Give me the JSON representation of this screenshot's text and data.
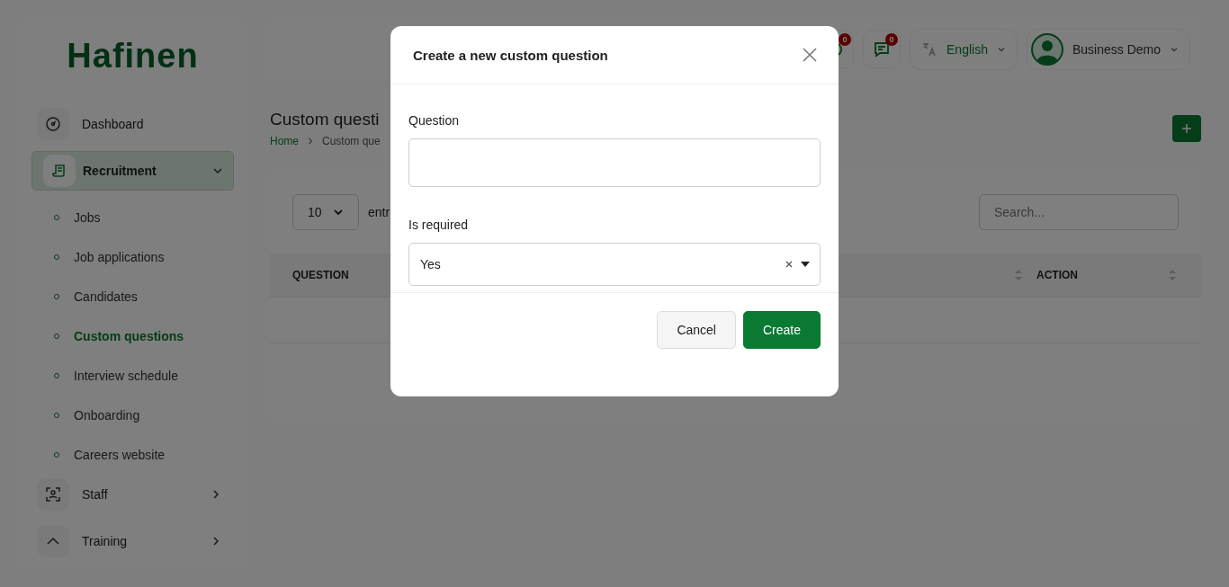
{
  "logo": "Hafinen",
  "sidebar": {
    "items": [
      {
        "label": "Dashboard",
        "kind": "link",
        "selected": false
      },
      {
        "label": "Recruitment",
        "kind": "group",
        "expanded": true,
        "selected": true,
        "children": [
          {
            "label": "Jobs",
            "selected": false
          },
          {
            "label": "Job applications",
            "selected": false
          },
          {
            "label": "Candidates",
            "selected": false
          },
          {
            "label": "Custom questions",
            "selected": true
          },
          {
            "label": "Interview schedule",
            "selected": false
          },
          {
            "label": "Onboarding",
            "selected": false
          },
          {
            "label": "Careers website",
            "selected": false
          }
        ]
      },
      {
        "label": "Staff",
        "kind": "group",
        "expanded": false,
        "selected": false
      },
      {
        "label": "Training",
        "kind": "group",
        "expanded": false,
        "selected": false
      }
    ]
  },
  "topbar": {
    "notifications": [
      {
        "kind": "chat",
        "count": "0"
      },
      {
        "kind": "message",
        "count": "0"
      }
    ],
    "language": "English",
    "user": "Business Demo"
  },
  "page": {
    "title": "Custom questi",
    "breadcrumb": [
      "Home",
      "Custom que"
    ]
  },
  "table": {
    "page_size": "10",
    "entries_label": "entr",
    "search_placeholder": "Search...",
    "columns": [
      "QUESTION",
      "ACTION"
    ]
  },
  "modal": {
    "title": "Create a new custom question",
    "fields": [
      {
        "kind": "text",
        "label": "Question"
      },
      {
        "kind": "select",
        "label": "Is required",
        "value": "Yes"
      }
    ],
    "buttons": [
      {
        "label": "Cancel",
        "kind": "secondary"
      },
      {
        "label": "Create",
        "kind": "primary"
      }
    ]
  }
}
